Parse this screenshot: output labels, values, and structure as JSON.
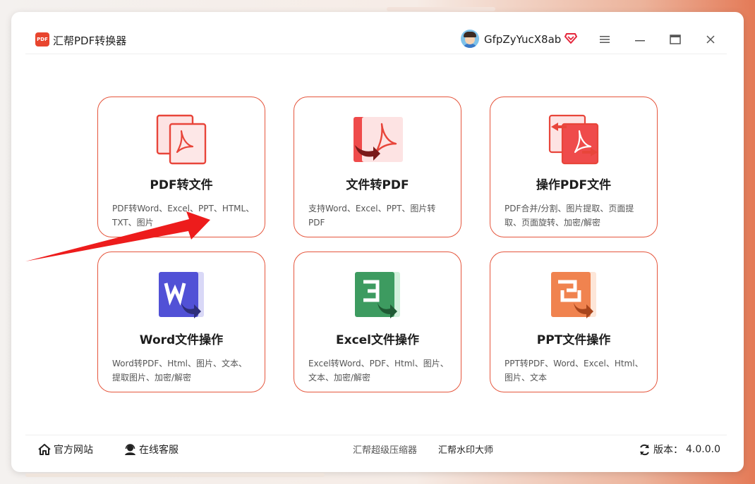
{
  "app": {
    "logo_text": "PDF",
    "title": "汇帮PDF转换器",
    "username": "GfpZyYucX8ab",
    "accent": "#e5553c"
  },
  "window_controls": [
    "menu-icon",
    "minimize-icon",
    "maximize-icon",
    "close-icon"
  ],
  "cards": [
    {
      "title": "PDF转文件",
      "desc": "PDF转Word、Excel、PPT、HTML、TXT、图片",
      "icon": "pdf-to-file-icon"
    },
    {
      "title": "文件转PDF",
      "desc": "支持Word、Excel、PPT、图片转PDF",
      "icon": "file-to-pdf-icon"
    },
    {
      "title": "操作PDF文件",
      "desc": "PDF合并/分割、图片提取、页面提取、页面旋转、加密/解密",
      "icon": "pdf-operate-icon"
    },
    {
      "title": "Word文件操作",
      "desc": "Word转PDF、Html、图片、文本、提取图片、加密/解密",
      "icon": "word-icon"
    },
    {
      "title": "Excel文件操作",
      "desc": "Excel转Word、PDF、Html、图片、文本、加密/解密",
      "icon": "excel-icon"
    },
    {
      "title": "PPT文件操作",
      "desc": "PPT转PDF、Word、Excel、Html、图片、文本",
      "icon": "ppt-icon"
    }
  ],
  "footer": {
    "official_site": "官方网站",
    "online_service": "在线客服",
    "link1": "汇帮超级压缩器",
    "link2": "汇帮水印大师",
    "version_label": "版本：",
    "version": "4.0.0.0"
  }
}
